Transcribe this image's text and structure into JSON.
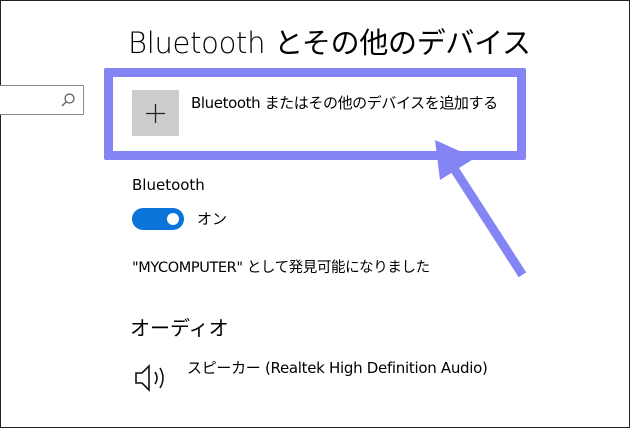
{
  "page": {
    "title": "Bluetooth とその他のデバイス"
  },
  "search": {
    "icon": "search-icon"
  },
  "add_device": {
    "label": "Bluetooth またはその他のデバイスを追加する",
    "icon": "plus-icon"
  },
  "bluetooth": {
    "section_label": "Bluetooth",
    "toggle_state": "オン",
    "toggle_on": true,
    "toggle_color": "#0a74d9",
    "discoverable_text": "\"MYCOMPUTER\" として発見可能になりました"
  },
  "audio": {
    "heading": "オーディオ",
    "devices": [
      {
        "name": "スピーカー (Realtek High Definition Audio)",
        "icon": "speaker-icon"
      }
    ]
  },
  "annotation": {
    "color": "#8484f5"
  }
}
